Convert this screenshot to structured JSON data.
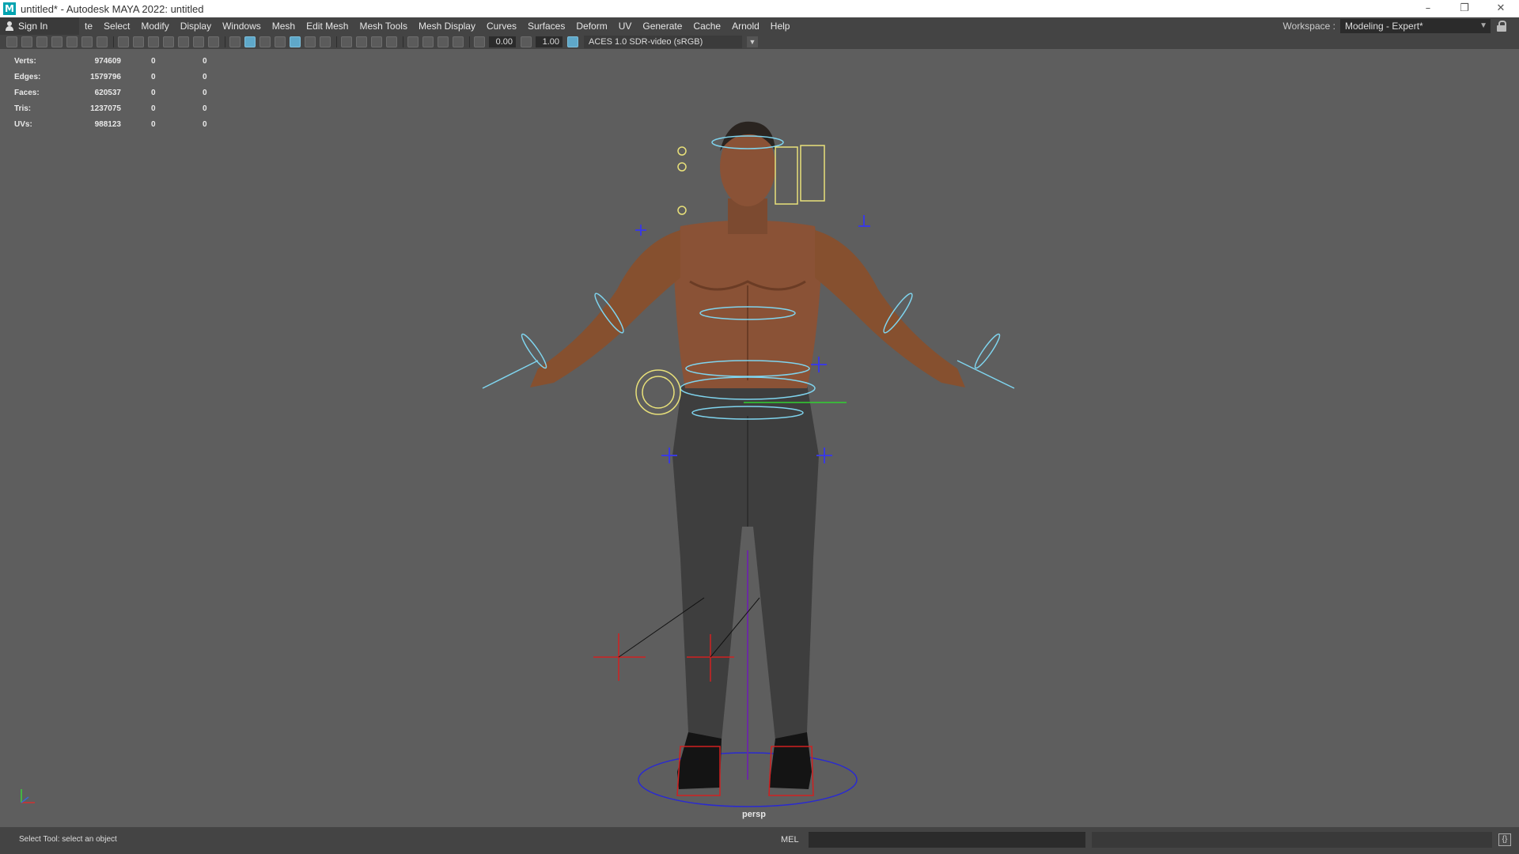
{
  "titlebar": {
    "logo": "M",
    "title": "untitled* - Autodesk MAYA 2022: untitled",
    "minimize": "–",
    "restore": "❐",
    "close": "✕"
  },
  "menubar": {
    "sign_in": "Sign In",
    "items": [
      "te",
      "Select",
      "Modify",
      "Display",
      "Windows",
      "Mesh",
      "Edit Mesh",
      "Mesh Tools",
      "Mesh Display",
      "Curves",
      "Surfaces",
      "Deform",
      "UV",
      "Generate",
      "Cache",
      "Arnold",
      "Help"
    ],
    "workspace_label": "Workspace :",
    "workspace_value": "Modeling - Expert*"
  },
  "panel_toolbar": {
    "exposure": "0.00",
    "gamma": "1.00",
    "color_space": "ACES 1.0 SDR-video (sRGB)"
  },
  "hud": {
    "rows": [
      {
        "label": "Verts:",
        "v1": "974609",
        "v2": "0",
        "v3": "0"
      },
      {
        "label": "Edges:",
        "v1": "1579796",
        "v2": "0",
        "v3": "0"
      },
      {
        "label": "Faces:",
        "v1": "620537",
        "v2": "0",
        "v3": "0"
      },
      {
        "label": "Tris:",
        "v1": "1237075",
        "v2": "0",
        "v3": "0"
      },
      {
        "label": "UVs:",
        "v1": "988123",
        "v2": "0",
        "v3": "0"
      }
    ]
  },
  "viewport": {
    "camera": "persp"
  },
  "cmdline": {
    "status": "Select Tool: select an object",
    "mel_label": "MEL"
  },
  "colors": {
    "menubar_bg": "#444444",
    "viewport_bg": "#5e5e5e",
    "skin": "#8a5236",
    "jeans": "#3e3e3e",
    "control_cyan": "#7fd4ee",
    "control_yellow": "#e8e07a",
    "control_blue": "#3a3ae0",
    "control_red": "#d02020"
  }
}
